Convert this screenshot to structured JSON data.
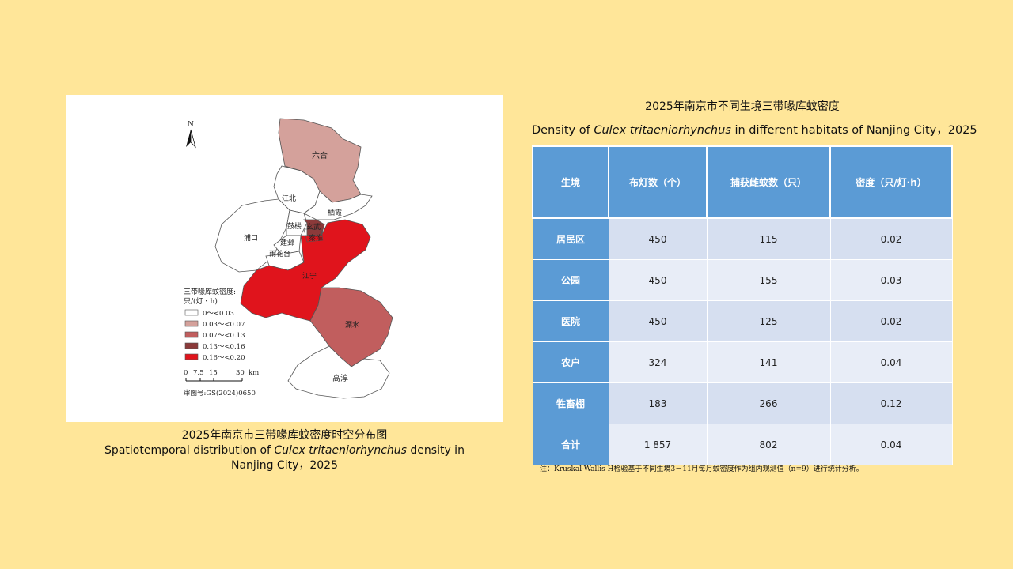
{
  "map": {
    "north": "N",
    "districts": {
      "liuhe": "六合",
      "jiangbei": "江北",
      "qixia": "栖霞",
      "pukou": "浦口",
      "gulou": "鼓楼",
      "xuanwu": "玄武",
      "qinhuai": "秦淮",
      "jianye": "建邺",
      "yuhuatai": "雨花台",
      "jiangning": "江宁",
      "lishui": "溧水",
      "gaochun": "高淳"
    },
    "legend": {
      "title_line1": "三带喙库蚊密度:",
      "title_line2": "只/(灯・h)",
      "items": [
        {
          "label": "0～<0.03",
          "color": "#ffffff"
        },
        {
          "label": "0.03～<0.07",
          "color": "#d4a19b"
        },
        {
          "label": "0.07～<0.13",
          "color": "#c15e5e"
        },
        {
          "label": "0.13～<0.16",
          "color": "#8b3a3a"
        },
        {
          "label": "0.16～<0.20",
          "color": "#e0141c"
        }
      ]
    },
    "scalebar": {
      "t0": "0",
      "t1": "7.5",
      "t2": "15",
      "t3": "30",
      "unit": "km"
    },
    "approval": "审图号:GS(2024)0650",
    "colors": {
      "liuhe": "#d4a19b",
      "jiangning": "#e0141c",
      "lishui": "#c15e5e",
      "xuanwu": "#8b3a3a",
      "other": "#ffffff"
    }
  },
  "caption": {
    "zh": "2025年南京市三带喙库蚊密度时空分布图",
    "en_pre": "Spatiotemporal  distribution of ",
    "en_italic": "Culex tritaeniorhynchus",
    "en_post": " density in Nanjing City，2025"
  },
  "table": {
    "title_zh": "2025年南京市不同生境三带喙库蚊密度",
    "title_en_pre": "Density of ",
    "title_en_italic": "Culex tritaeniorhynchus",
    "title_en_post": " in different habitats of Nanjing City，2025",
    "headers": [
      "生境",
      "布灯数（个）",
      "捕获雌蚊数（只）",
      "密度（只/灯·h）"
    ],
    "rows": [
      [
        "居民区",
        "450",
        "115",
        "0.02"
      ],
      [
        "公园",
        "450",
        "155",
        "0.03"
      ],
      [
        "医院",
        "450",
        "125",
        "0.02"
      ],
      [
        "农户",
        "324",
        "141",
        "0.04"
      ],
      [
        "牲畜棚",
        "183",
        "266",
        "0.12"
      ],
      [
        "合计",
        "1 857",
        "802",
        "0.04"
      ]
    ],
    "header_color": "#5b9bd5",
    "note": "注：Kruskal-Wallis H检验基于不同生境3－11月每月蚊密度作为组内观测值（n=9）进行统计分析。"
  }
}
